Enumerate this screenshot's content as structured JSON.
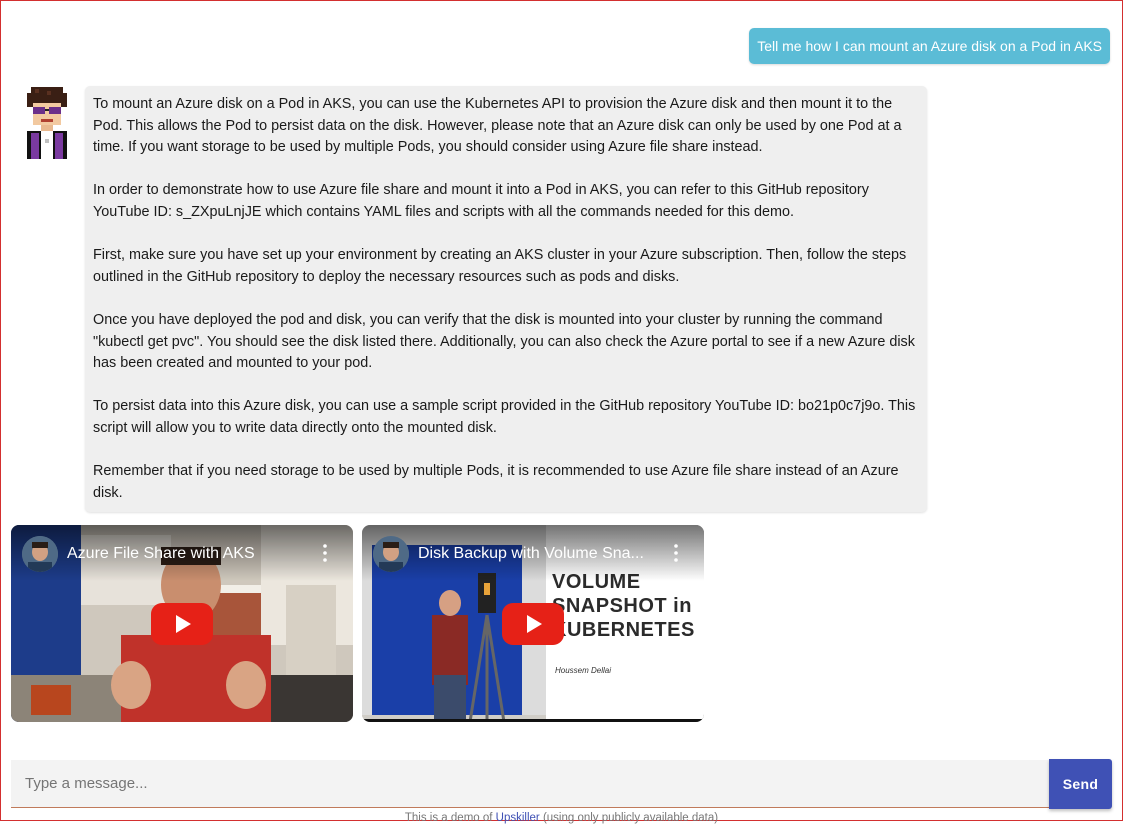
{
  "chat": {
    "user_message": "Tell me how I can mount an Azure disk on a Pod in AKS",
    "bot_paragraphs": [
      "To mount an Azure disk on a Pod in AKS, you can use the Kubernetes API to provision the Azure disk and then mount it to the Pod. This allows the Pod to persist data on the disk. However, please note that an Azure disk can only be used by one Pod at a time. If you want storage to be used by multiple Pods, you should consider using Azure file share instead.",
      "In order to demonstrate how to use Azure file share and mount it into a Pod in AKS, you can refer to this GitHub repository YouTube ID: s_ZXpuLnjJE which contains YAML files and scripts with all the commands needed for this demo.",
      "First, make sure you have set up your environment by creating an AKS cluster in your Azure subscription. Then, follow the steps outlined in the GitHub repository to deploy the necessary resources such as pods and disks.",
      "Once you have deployed the pod and disk, you can verify that the disk is mounted into your cluster by running the command \"kubectl get pvc\". You should see the disk listed there. Additionally, you can also check the Azure portal to see if a new Azure disk has been created and mounted to your pod.",
      "To persist data into this Azure disk, you can use a sample script provided in the GitHub repository YouTube ID: bo21p0c7j9o. This script will allow you to write data directly onto the mounted disk.",
      "Remember that if you need storage to be used by multiple Pods, it is recommended to use Azure file share instead of an Azure disk."
    ]
  },
  "videos": [
    {
      "title": "Azure File Share with AKS",
      "icons": [
        "channel-avatar",
        "kebab-menu-icon",
        "play-icon"
      ]
    },
    {
      "title": "Disk Backup with Volume Sna...",
      "overlay_line1": "VOLUME",
      "overlay_line2": "SNAPSHOT in",
      "overlay_line3": "KUBERNETES",
      "overlay_author": "Houssem Dellai"
    }
  ],
  "composer": {
    "placeholder": "Type a message...",
    "send_label": "Send"
  },
  "footer": {
    "prefix": "This is a demo of ",
    "link": "Upskiller",
    "suffix": " (using only publicly available data)"
  },
  "colors": {
    "user_bubble": "#5bbcd6",
    "bot_bubble": "#efefef",
    "send_button": "#3f51b5",
    "play_button": "#e62117"
  }
}
